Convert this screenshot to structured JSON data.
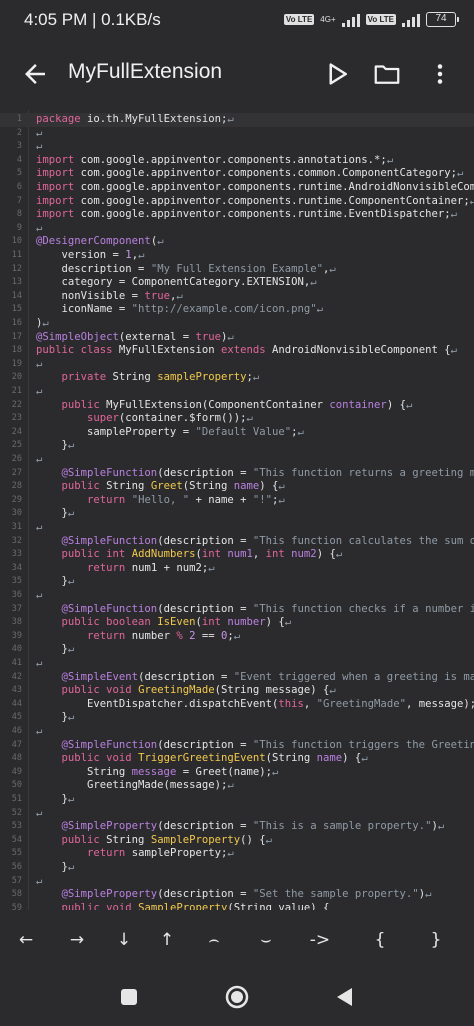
{
  "status": {
    "time": "4:05 PM | 0.1KB/s",
    "sim1": "Vo LTE",
    "sim1_net": "4G+",
    "sim2": "Vo LTE",
    "battery": "74"
  },
  "app_bar": {
    "title": "MyFullExtension"
  },
  "editor": {
    "lines": [
      [
        {
          "t": "package ",
          "c": "k"
        },
        {
          "t": "io.th.MyFullExtension;"
        },
        {
          "t": "↵",
          "c": "s"
        }
      ],
      [
        {
          "t": "↵",
          "c": "s"
        }
      ],
      [
        {
          "t": "↵",
          "c": "s"
        }
      ],
      [
        {
          "t": "import ",
          "c": "k"
        },
        {
          "t": "com.google.appinventor.components.annotations.*;"
        },
        {
          "t": "↵",
          "c": "s"
        }
      ],
      [
        {
          "t": "import ",
          "c": "k"
        },
        {
          "t": "com.google.appinventor.components.common.ComponentCategory;"
        },
        {
          "t": "↵",
          "c": "s"
        }
      ],
      [
        {
          "t": "import ",
          "c": "k"
        },
        {
          "t": "com.google.appinventor.components.runtime.AndroidNonvisibleCompone"
        }
      ],
      [
        {
          "t": "import ",
          "c": "k"
        },
        {
          "t": "com.google.appinventor.components.runtime.ComponentContainer;"
        },
        {
          "t": "↵",
          "c": "s"
        }
      ],
      [
        {
          "t": "import ",
          "c": "k"
        },
        {
          "t": "com.google.appinventor.components.runtime.EventDispatcher;"
        },
        {
          "t": "↵",
          "c": "s"
        }
      ],
      [
        {
          "t": "↵",
          "c": "s"
        }
      ],
      [
        {
          "t": "@DesignerComponent",
          "c": "a"
        },
        {
          "t": "("
        },
        {
          "t": "↵",
          "c": "s"
        }
      ],
      [
        {
          "t": "    version = "
        },
        {
          "t": "1",
          "c": "n"
        },
        {
          "t": ","
        },
        {
          "t": "↵",
          "c": "s"
        }
      ],
      [
        {
          "t": "    description = "
        },
        {
          "t": "\"My Full Extension Example\"",
          "c": "s"
        },
        {
          "t": ","
        },
        {
          "t": "↵",
          "c": "s"
        }
      ],
      [
        {
          "t": "    category = ComponentCategory.EXTENSION,"
        },
        {
          "t": "↵",
          "c": "s"
        }
      ],
      [
        {
          "t": "    nonVisible = "
        },
        {
          "t": "true",
          "c": "k"
        },
        {
          "t": ","
        },
        {
          "t": "↵",
          "c": "s"
        }
      ],
      [
        {
          "t": "    iconName = "
        },
        {
          "t": "\"http://example.com/icon.png\"",
          "c": "s"
        },
        {
          "t": "↵",
          "c": "s"
        }
      ],
      [
        {
          "t": ")"
        },
        {
          "t": "↵",
          "c": "s"
        }
      ],
      [
        {
          "t": "@SimpleObject",
          "c": "a"
        },
        {
          "t": "(external = "
        },
        {
          "t": "true",
          "c": "k"
        },
        {
          "t": ")"
        },
        {
          "t": "↵",
          "c": "s"
        }
      ],
      [
        {
          "t": "public class ",
          "c": "k"
        },
        {
          "t": "MyFullExtension "
        },
        {
          "t": "extends ",
          "c": "k"
        },
        {
          "t": "AndroidNonvisibleComponent {"
        },
        {
          "t": "↵",
          "c": "s"
        }
      ],
      [
        {
          "t": "↵",
          "c": "s"
        }
      ],
      [
        {
          "t": "    "
        },
        {
          "t": "private ",
          "c": "k"
        },
        {
          "t": "String "
        },
        {
          "t": "sampleProperty",
          "c": "f"
        },
        {
          "t": ";"
        },
        {
          "t": "↵",
          "c": "s"
        }
      ],
      [
        {
          "t": "↵",
          "c": "s"
        }
      ],
      [
        {
          "t": "    "
        },
        {
          "t": "public ",
          "c": "k"
        },
        {
          "t": "MyFullExtension(ComponentContainer "
        },
        {
          "t": "container",
          "c": "p"
        },
        {
          "t": ") {"
        },
        {
          "t": "↵",
          "c": "s"
        }
      ],
      [
        {
          "t": "        "
        },
        {
          "t": "super",
          "c": "k"
        },
        {
          "t": "(container.$form());"
        },
        {
          "t": "↵",
          "c": "s"
        }
      ],
      [
        {
          "t": "        sampleProperty = "
        },
        {
          "t": "\"Default Value\"",
          "c": "s"
        },
        {
          "t": ";"
        },
        {
          "t": "↵",
          "c": "s"
        }
      ],
      [
        {
          "t": "    }"
        },
        {
          "t": "↵",
          "c": "s"
        }
      ],
      [
        {
          "t": "↵",
          "c": "s"
        }
      ],
      [
        {
          "t": "    "
        },
        {
          "t": "@SimpleFunction",
          "c": "a"
        },
        {
          "t": "(description = "
        },
        {
          "t": "\"This function returns a greeting mes",
          "c": "s"
        }
      ],
      [
        {
          "t": "    "
        },
        {
          "t": "public ",
          "c": "k"
        },
        {
          "t": "String "
        },
        {
          "t": "Greet",
          "c": "f"
        },
        {
          "t": "(String "
        },
        {
          "t": "name",
          "c": "p"
        },
        {
          "t": ") {"
        },
        {
          "t": "↵",
          "c": "s"
        }
      ],
      [
        {
          "t": "        "
        },
        {
          "t": "return ",
          "c": "k"
        },
        {
          "t": "\"Hello, \"",
          "c": "s"
        },
        {
          "t": " + name + "
        },
        {
          "t": "\"!\"",
          "c": "s"
        },
        {
          "t": ";"
        },
        {
          "t": "↵",
          "c": "s"
        }
      ],
      [
        {
          "t": "    }"
        },
        {
          "t": "↵",
          "c": "s"
        }
      ],
      [
        {
          "t": "↵",
          "c": "s"
        }
      ],
      [
        {
          "t": "    "
        },
        {
          "t": "@SimpleFunction",
          "c": "a"
        },
        {
          "t": "(description = "
        },
        {
          "t": "\"This function calculates the sum of t",
          "c": "s"
        }
      ],
      [
        {
          "t": "    "
        },
        {
          "t": "public int ",
          "c": "k"
        },
        {
          "t": "AddNumbers",
          "c": "f"
        },
        {
          "t": "("
        },
        {
          "t": "int ",
          "c": "k"
        },
        {
          "t": "num1",
          "c": "p"
        },
        {
          "t": ", "
        },
        {
          "t": "int ",
          "c": "k"
        },
        {
          "t": "num2",
          "c": "p"
        },
        {
          "t": ") {"
        },
        {
          "t": "↵",
          "c": "s"
        }
      ],
      [
        {
          "t": "        "
        },
        {
          "t": "return ",
          "c": "k"
        },
        {
          "t": "num1 + num2;"
        },
        {
          "t": "↵",
          "c": "s"
        }
      ],
      [
        {
          "t": "    }"
        },
        {
          "t": "↵",
          "c": "s"
        }
      ],
      [
        {
          "t": "↵",
          "c": "s"
        }
      ],
      [
        {
          "t": "    "
        },
        {
          "t": "@SimpleFunction",
          "c": "a"
        },
        {
          "t": "(description = "
        },
        {
          "t": "\"This function checks if a number is e",
          "c": "s"
        }
      ],
      [
        {
          "t": "    "
        },
        {
          "t": "public boolean ",
          "c": "k"
        },
        {
          "t": "IsEven",
          "c": "f"
        },
        {
          "t": "("
        },
        {
          "t": "int ",
          "c": "k"
        },
        {
          "t": "number",
          "c": "p"
        },
        {
          "t": ") {"
        },
        {
          "t": "↵",
          "c": "s"
        }
      ],
      [
        {
          "t": "        "
        },
        {
          "t": "return ",
          "c": "k"
        },
        {
          "t": "number "
        },
        {
          "t": "% ",
          "c": "k"
        },
        {
          "t": "2",
          "c": "n"
        },
        {
          "t": " == "
        },
        {
          "t": "0",
          "c": "n"
        },
        {
          "t": ";"
        },
        {
          "t": "↵",
          "c": "s"
        }
      ],
      [
        {
          "t": "    }"
        },
        {
          "t": "↵",
          "c": "s"
        }
      ],
      [
        {
          "t": "↵",
          "c": "s"
        }
      ],
      [
        {
          "t": "    "
        },
        {
          "t": "@SimpleEvent",
          "c": "a"
        },
        {
          "t": "(description = "
        },
        {
          "t": "\"Event triggered when a greeting is made",
          "c": "s"
        }
      ],
      [
        {
          "t": "    "
        },
        {
          "t": "public void ",
          "c": "k"
        },
        {
          "t": "GreetingMade",
          "c": "f"
        },
        {
          "t": "(String message) {"
        },
        {
          "t": "↵",
          "c": "s"
        }
      ],
      [
        {
          "t": "        EventDispatcher.dispatchEvent("
        },
        {
          "t": "this",
          "c": "k"
        },
        {
          "t": ", "
        },
        {
          "t": "\"GreetingMade\"",
          "c": "s"
        },
        {
          "t": ", message);"
        },
        {
          "t": "↵",
          "c": "s"
        }
      ],
      [
        {
          "t": "    }"
        },
        {
          "t": "↵",
          "c": "s"
        }
      ],
      [
        {
          "t": "↵",
          "c": "s"
        }
      ],
      [
        {
          "t": "    "
        },
        {
          "t": "@SimpleFunction",
          "c": "a"
        },
        {
          "t": "(description = "
        },
        {
          "t": "\"This function triggers the GreetingMa",
          "c": "s"
        }
      ],
      [
        {
          "t": "    "
        },
        {
          "t": "public void ",
          "c": "k"
        },
        {
          "t": "TriggerGreetingEvent",
          "c": "f"
        },
        {
          "t": "(String "
        },
        {
          "t": "name",
          "c": "p"
        },
        {
          "t": ") {"
        },
        {
          "t": "↵",
          "c": "s"
        }
      ],
      [
        {
          "t": "        String "
        },
        {
          "t": "message",
          "c": "p"
        },
        {
          "t": " = Greet(name);"
        },
        {
          "t": "↵",
          "c": "s"
        }
      ],
      [
        {
          "t": "        GreetingMade(message);"
        },
        {
          "t": "↵",
          "c": "s"
        }
      ],
      [
        {
          "t": "    }"
        },
        {
          "t": "↵",
          "c": "s"
        }
      ],
      [
        {
          "t": "↵",
          "c": "s"
        }
      ],
      [
        {
          "t": "    "
        },
        {
          "t": "@SimpleProperty",
          "c": "a"
        },
        {
          "t": "(description = "
        },
        {
          "t": "\"This is a sample property.\"",
          "c": "s"
        },
        {
          "t": ")"
        },
        {
          "t": "↵",
          "c": "s"
        }
      ],
      [
        {
          "t": "    "
        },
        {
          "t": "public ",
          "c": "k"
        },
        {
          "t": "String "
        },
        {
          "t": "SampleProperty",
          "c": "f"
        },
        {
          "t": "() {"
        },
        {
          "t": "↵",
          "c": "s"
        }
      ],
      [
        {
          "t": "        "
        },
        {
          "t": "return ",
          "c": "k"
        },
        {
          "t": "sampleProperty;"
        },
        {
          "t": "↵",
          "c": "s"
        }
      ],
      [
        {
          "t": "    }"
        },
        {
          "t": "↵",
          "c": "s"
        }
      ],
      [
        {
          "t": "↵",
          "c": "s"
        }
      ],
      [
        {
          "t": "    "
        },
        {
          "t": "@SimpleProperty",
          "c": "a"
        },
        {
          "t": "(description = "
        },
        {
          "t": "\"Set the sample property.\"",
          "c": "s"
        },
        {
          "t": ")"
        },
        {
          "t": "↵",
          "c": "s"
        }
      ],
      [
        {
          "t": "    "
        },
        {
          "t": "public void ",
          "c": "k"
        },
        {
          "t": "SampleProperty",
          "c": "f"
        },
        {
          "t": "(String value) {"
        }
      ]
    ]
  },
  "keys": [
    "←",
    "→",
    "↓",
    "↑",
    "⌢",
    "⌣",
    "->",
    "{",
    "}"
  ],
  "icons": {
    "back": "arrow-left-icon",
    "run": "play-icon",
    "open": "folder-icon",
    "more": "more-vert-icon"
  }
}
